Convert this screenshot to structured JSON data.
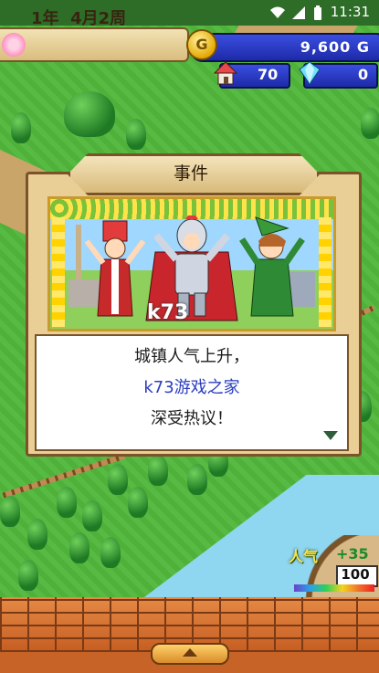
{
  "status_bar": {
    "time": "11:31"
  },
  "hud": {
    "date": {
      "year": "1年",
      "month": "4月",
      "week": "2周"
    },
    "money": {
      "coin_symbol": "G",
      "amount": "9,600 G"
    },
    "houses": "70",
    "crystals": "0"
  },
  "dialog": {
    "title": "事件",
    "lines": [
      "城镇人气上升，",
      "k73游戏之家",
      "深受热议！"
    ],
    "watermark": "k73"
  },
  "popularity": {
    "label": "人气",
    "trend": "+35",
    "value": "100"
  },
  "menu": {
    "expand_icon": "up-arrow-icon"
  },
  "colors": {
    "accent_blue": "#2a3dbf",
    "dialog_bg": "#e9cf96",
    "brick": "#d9692a"
  }
}
